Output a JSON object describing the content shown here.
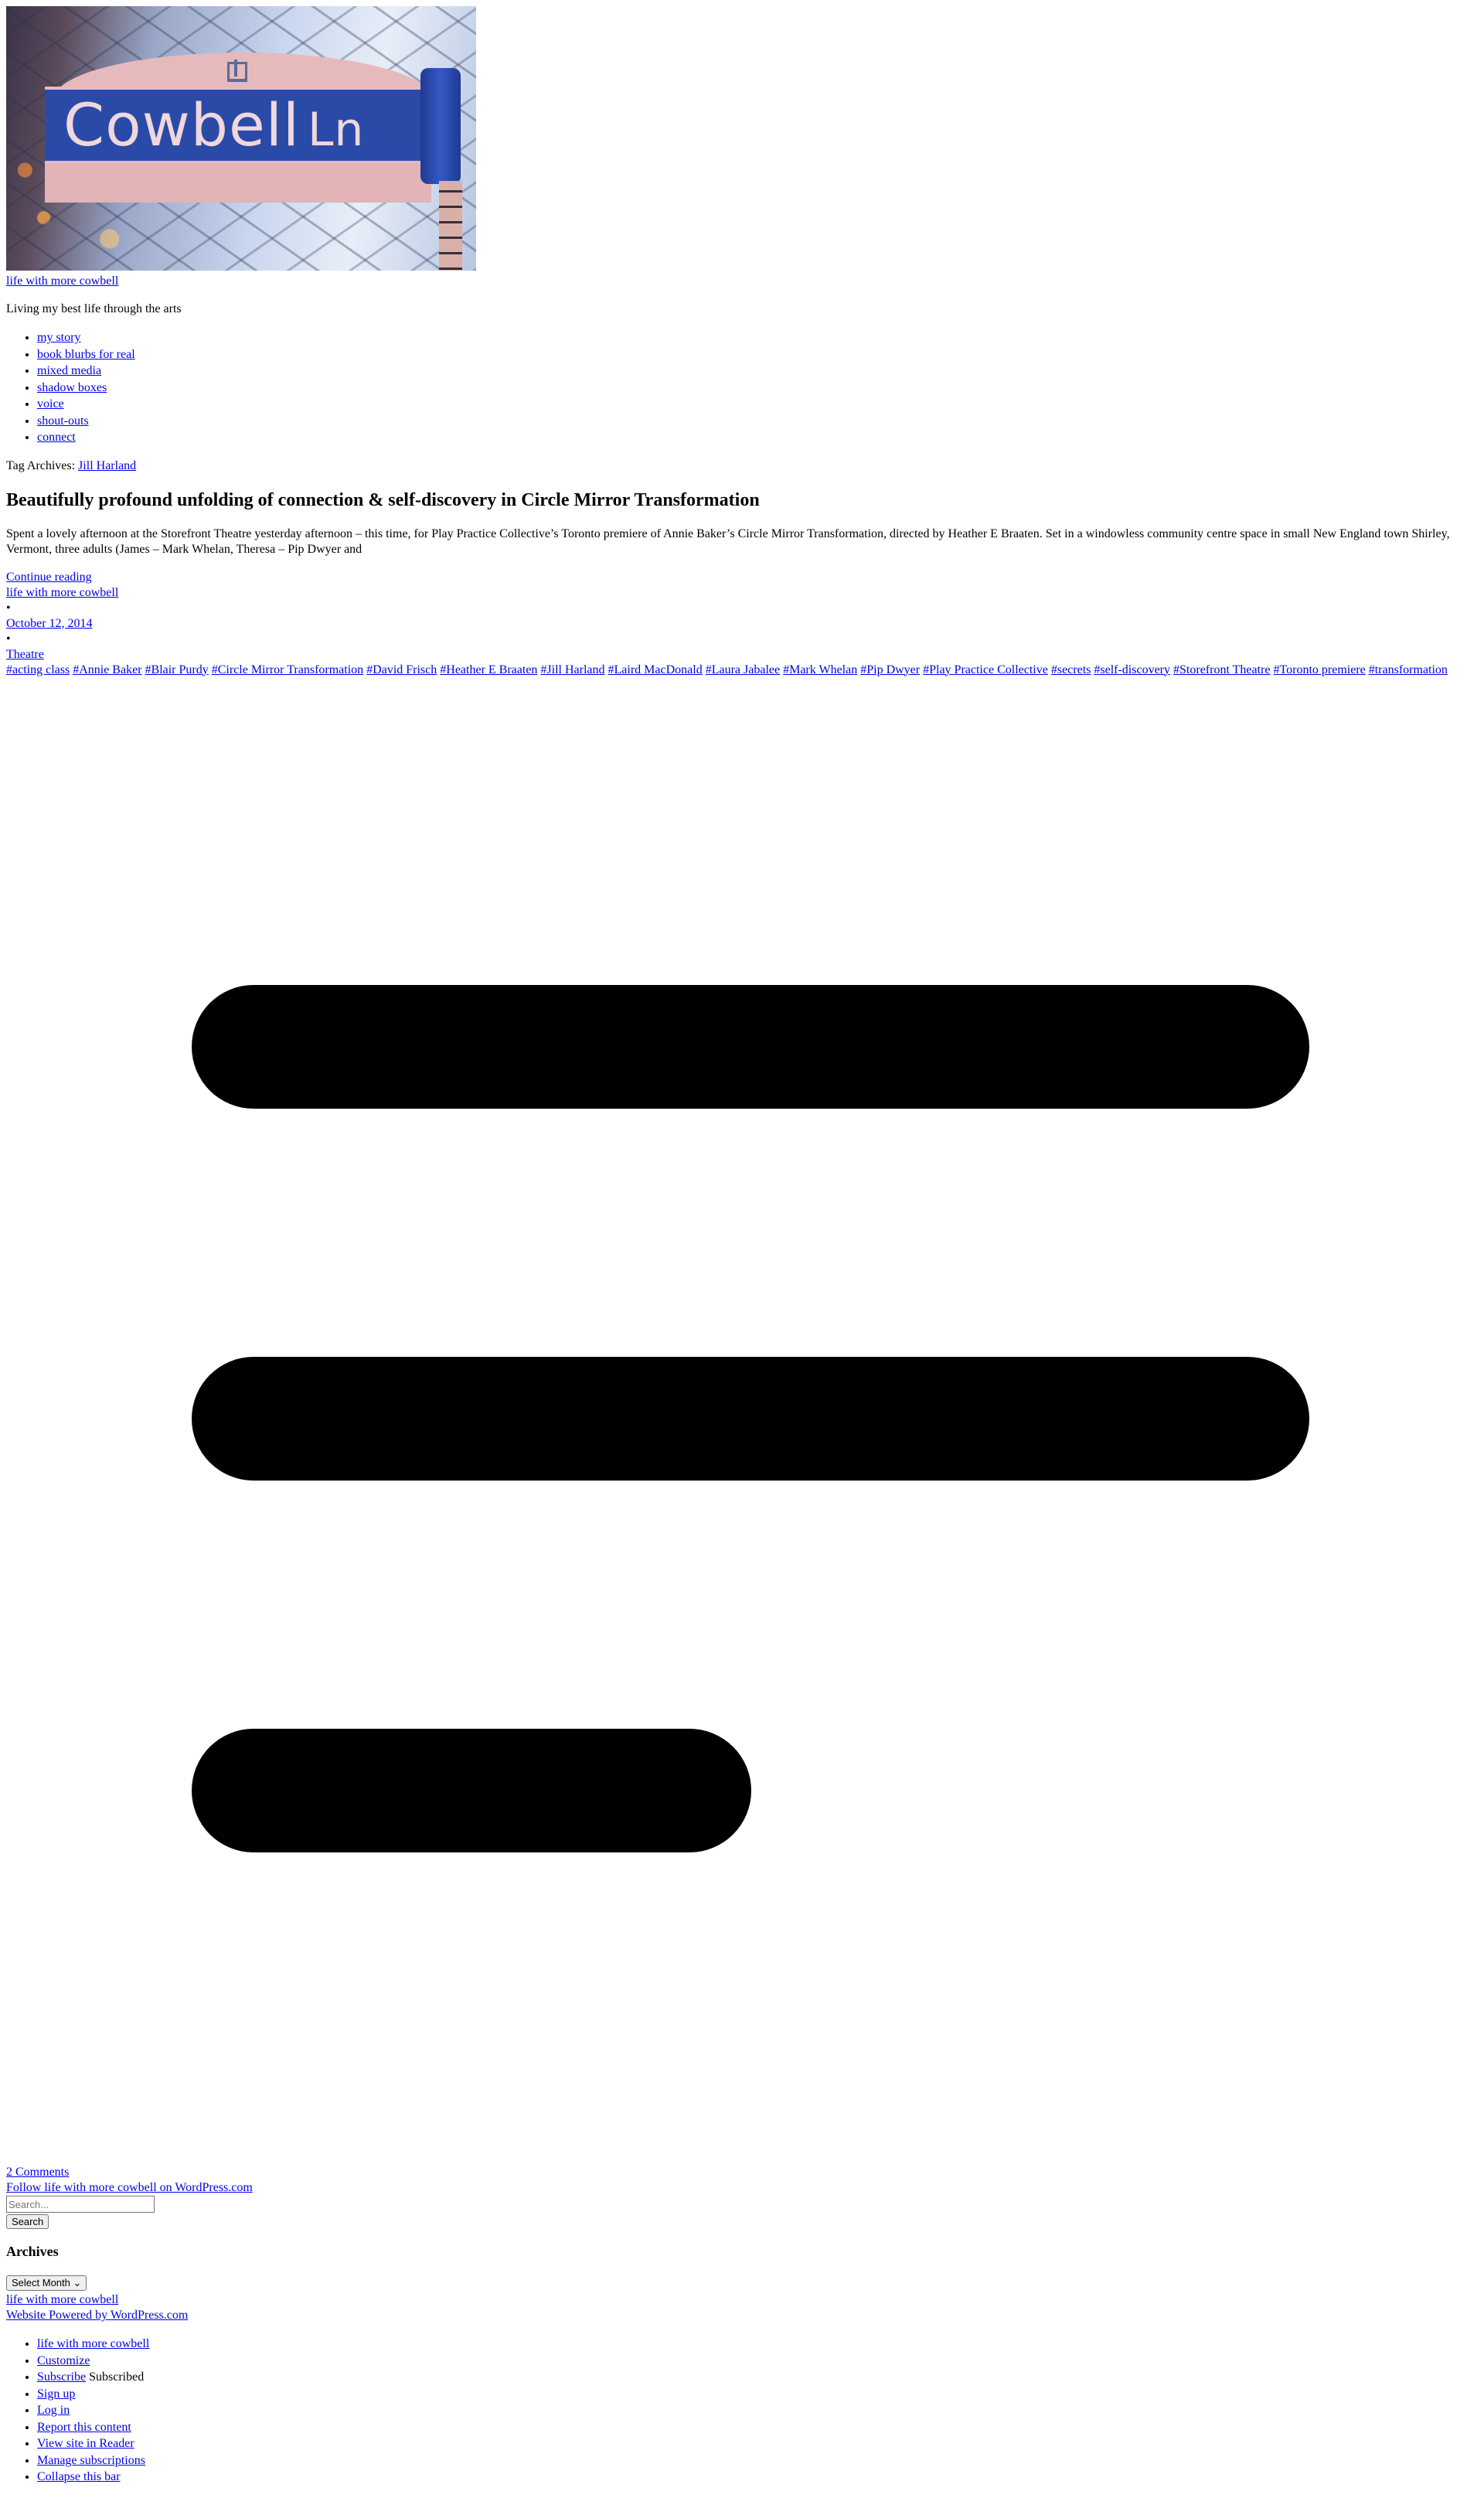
{
  "header": {
    "sign_main": "Cowbell",
    "sign_suffix": "Ln",
    "site_title": "life with more cowbell",
    "tagline": "Living my best life through the arts"
  },
  "nav": {
    "items": [
      "my story",
      "book blurbs for real",
      "mixed media",
      "shadow boxes",
      "voice",
      "shout-outs",
      "connect"
    ]
  },
  "archive": {
    "prefix": "Tag Archives:",
    "tag": "Jill Harland"
  },
  "post": {
    "title": "Beautifully profound unfolding of connection & self-discovery in Circle Mirror Transformation",
    "excerpt": "Spent a lovely afternoon at the Storefront Theatre yesterday afternoon – this time, for Play Practice Collective’s Toronto premiere of Annie Baker’s Circle Mirror Transformation, directed by Heather E Braaten. Set in a windowless community centre space in small New England town Shirley, Vermont, three adults (James – Mark Whelan, Theresa – Pip Dwyer and",
    "continue": "Continue reading",
    "author": "life with more cowbell",
    "bullet": "•",
    "date": "October 12, 2014",
    "category": "Theatre",
    "tags": [
      "#acting class",
      "#Annie Baker",
      "#Blair Purdy",
      "#Circle Mirror Transformation",
      "#David Frisch",
      "#Heather E Braaten",
      "#Jill Harland",
      "#Laird MacDonald",
      "#Laura Jabalee",
      "#Mark Whelan",
      "#Pip Dwyer",
      "#Play Practice Collective",
      "#secrets",
      "#self-discovery",
      "#Storefront Theatre",
      "#Toronto premiere",
      "#transformation"
    ],
    "comments": "2 Comments"
  },
  "sidebar": {
    "follow": "Follow life with more cowbell on WordPress.com",
    "search_placeholder": "Search...",
    "search_button": "Search",
    "archives_title": "Archives",
    "archives_select": "Select Month",
    "site_link": "life with more cowbell",
    "powered": "Website Powered by WordPress.com"
  },
  "admin_bar": {
    "items": [
      "life with more cowbell",
      "Customize",
      "Subscribe",
      "Sign up",
      "Log in",
      "Report this content",
      "View site in Reader",
      "Manage subscriptions",
      "Collapse this bar"
    ],
    "subscribed_label": "Subscribed"
  },
  "colors": {
    "link": "#0000ee",
    "text": "#000000",
    "placeholder_block": "#000000",
    "sign_blue": "#2a4aa8"
  }
}
